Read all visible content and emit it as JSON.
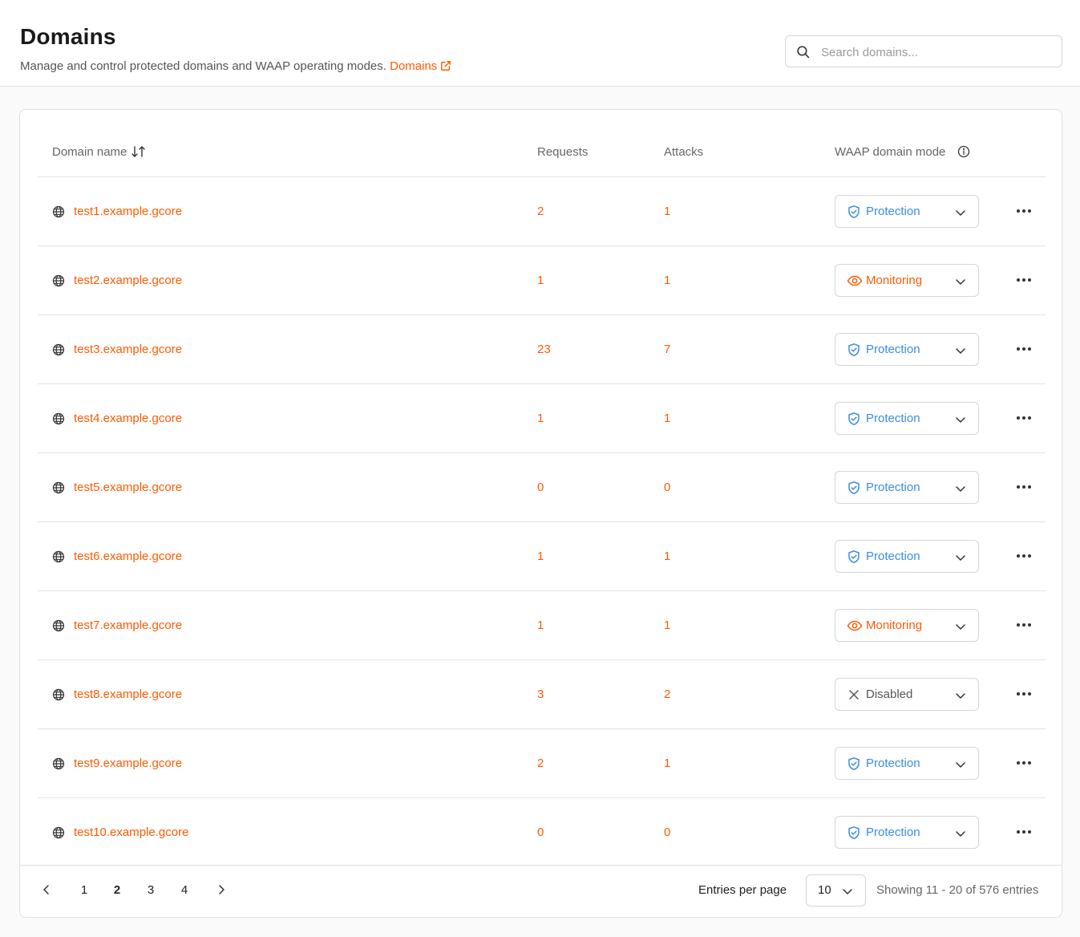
{
  "header": {
    "title": "Domains",
    "subtitle": "Manage and control protected domains and WAAP operating modes.",
    "doc_link": "Domains"
  },
  "search": {
    "placeholder": "Search domains..."
  },
  "table": {
    "columns": {
      "domain_name": "Domain name",
      "requests": "Requests",
      "attacks": "Attacks",
      "mode": "WAAP domain mode"
    },
    "rows": [
      {
        "domain": "test1.example.gcore",
        "requests": "2",
        "attacks": "1",
        "mode": "Protection"
      },
      {
        "domain": "test2.example.gcore",
        "requests": "1",
        "attacks": "1",
        "mode": "Monitoring"
      },
      {
        "domain": "test3.example.gcore",
        "requests": "23",
        "attacks": "7",
        "mode": "Protection"
      },
      {
        "domain": "test4.example.gcore",
        "requests": "1",
        "attacks": "1",
        "mode": "Protection"
      },
      {
        "domain": "test5.example.gcore",
        "requests": "0",
        "attacks": "0",
        "mode": "Protection"
      },
      {
        "domain": "test6.example.gcore",
        "requests": "1",
        "attacks": "1",
        "mode": "Protection"
      },
      {
        "domain": "test7.example.gcore",
        "requests": "1",
        "attacks": "1",
        "mode": "Monitoring"
      },
      {
        "domain": "test8.example.gcore",
        "requests": "3",
        "attacks": "2",
        "mode": "Disabled"
      },
      {
        "domain": "test9.example.gcore",
        "requests": "2",
        "attacks": "1",
        "mode": "Protection"
      },
      {
        "domain": "test10.example.gcore",
        "requests": "0",
        "attacks": "0",
        "mode": "Protection"
      }
    ]
  },
  "pagination": {
    "pages": [
      "1",
      "2",
      "3",
      "4"
    ],
    "current_page": "2",
    "entries_label": "Entries per page",
    "entries_value": "10",
    "showing": "Showing 11 - 20 of 576 entries"
  },
  "colors": {
    "accent": "#ff5a00",
    "protection": "#3a8de0",
    "disabled": "#555555"
  },
  "icons": {
    "search": "search-icon",
    "external_link": "external-link-icon",
    "sort": "sort-icon",
    "info": "info-icon",
    "globe": "globe-icon",
    "protection": "shield-icon",
    "monitoring": "eye-icon",
    "disabled": "x-icon",
    "chevron": "chevron-down-icon",
    "more": "more-horizontal-icon"
  }
}
